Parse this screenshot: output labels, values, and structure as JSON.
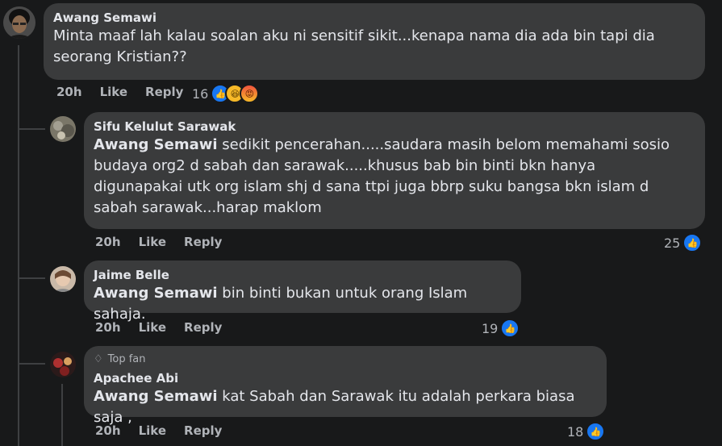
{
  "comments": [
    {
      "author": "Awang Semawi",
      "text": "Minta maaf lah kalau soalan aku ni sensitif sikit...kenapa nama dia ada bin tapi dia seorang Kristian??",
      "time": "20h",
      "like": "Like",
      "reply": "Reply",
      "reaction_count": "16"
    }
  ],
  "replies": [
    {
      "author": "Sifu Kelulut Sarawak",
      "mention": "Awang Semawi",
      "text": " sedikit pencerahan.....saudara masih belom memahami sosio budaya org2 d sabah dan sarawak.....khusus bab bin binti bkn hanya digunapakai utk org islam shj d sana ttpi juga bbrp suku bangsa bkn islam d sabah sarawak...harap maklom",
      "time": "20h",
      "like": "Like",
      "reply": "Reply",
      "reaction_count": "25"
    },
    {
      "author": "Jaime Belle",
      "mention": "Awang Semawi",
      "text": " bin binti bukan untuk orang Islam sahaja.",
      "time": "20h",
      "like": "Like",
      "reply": "Reply",
      "reaction_count": "19"
    },
    {
      "badge": "Top fan",
      "author": "Apachee Abi",
      "mention": "Awang Semawi",
      "text": " kat Sabah dan Sarawak itu adalah perkara biasa saja ,",
      "time": "20h",
      "like": "Like",
      "reply": "Reply",
      "reaction_count": "18"
    }
  ],
  "colors": {
    "background": "#18191a",
    "bubble": "#3a3b3c",
    "like_blue": "#1877f2",
    "muted": "#b0b3b8"
  },
  "icons": [
    "like-reaction-icon",
    "haha-reaction-icon",
    "angry-reaction-icon",
    "diamond-icon"
  ]
}
